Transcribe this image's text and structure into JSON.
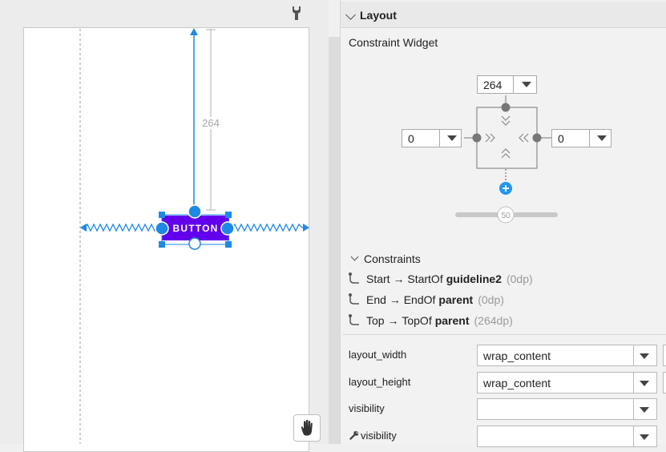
{
  "canvas": {
    "component_label": "BUTTON",
    "top_margin_label": "264",
    "button_color": "#6200ee",
    "selection_color": "#1e88e5"
  },
  "panel": {
    "section_title": "Layout",
    "constraint_widget_title": "Constraint Widget",
    "top_margin": "264",
    "start_margin": "0",
    "end_margin": "0",
    "bias": "50",
    "constraints_title": "Constraints",
    "constraints": [
      {
        "from": "Start",
        "arrow": "→",
        "to": "StartOf",
        "target": "guideline2",
        "margin": "(0dp)"
      },
      {
        "from": "End",
        "arrow": "→",
        "to": "EndOf",
        "target": "parent",
        "margin": "(0dp)"
      },
      {
        "from": "Top",
        "arrow": "→",
        "to": "TopOf",
        "target": "parent",
        "margin": "(264dp)"
      }
    ],
    "attributes": [
      {
        "label": "layout_width",
        "value": "wrap_content"
      },
      {
        "label": "layout_height",
        "value": "wrap_content"
      },
      {
        "label": "visibility",
        "value": ""
      },
      {
        "label": "visibility",
        "value": "",
        "icon": "wrench-icon"
      }
    ]
  }
}
